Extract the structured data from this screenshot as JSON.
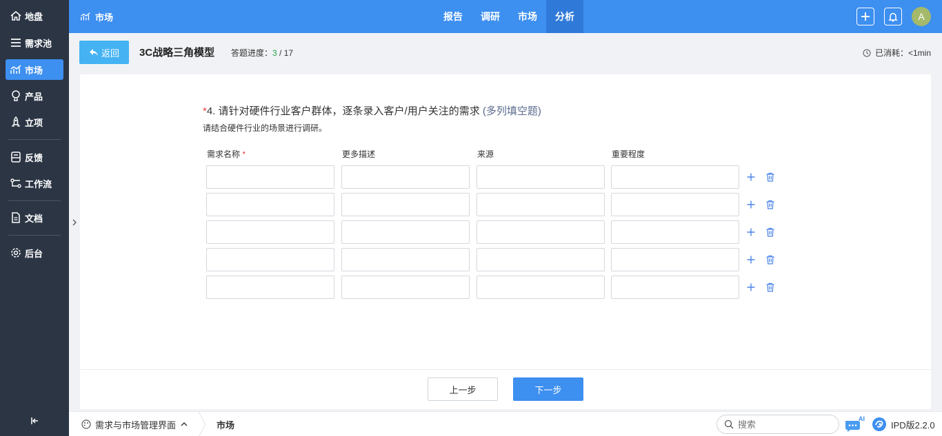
{
  "sidebar": {
    "items": [
      {
        "label": "地盘",
        "icon": "home-icon"
      },
      {
        "label": "需求池",
        "icon": "list-icon"
      },
      {
        "label": "市场",
        "icon": "market-chart-icon",
        "active": true
      },
      {
        "label": "产品",
        "icon": "lightbulb-icon"
      },
      {
        "label": "立项",
        "icon": "rocket-icon"
      },
      {
        "label": "反馈",
        "icon": "feedback-icon"
      },
      {
        "label": "工作流",
        "icon": "workflow-icon"
      },
      {
        "label": "文档",
        "icon": "document-icon"
      },
      {
        "label": "后台",
        "icon": "gear-icon"
      }
    ]
  },
  "topbar": {
    "brand": "市场",
    "nav": [
      "报告",
      "调研",
      "市场",
      "分析"
    ],
    "active_nav": "分析",
    "avatar_initial": "A"
  },
  "header": {
    "back_label": "返回",
    "title": "3C战略三角模型",
    "progress_label": "答题进度：",
    "progress_current": "3",
    "progress_total": " / 17",
    "elapsed_label": "已消耗：<1min"
  },
  "question": {
    "required_mark": "*",
    "title": "4. 请针对硬件行业客户群体，逐条录入客户/用户关注的需求",
    "type": " (多列填空题)",
    "description": "请结合硬件行业的场景进行调研。",
    "columns": [
      {
        "label": "需求名称",
        "required": true
      },
      {
        "label": "更多描述",
        "required": false
      },
      {
        "label": "来源",
        "required": false
      },
      {
        "label": "重要程度",
        "required": false
      }
    ],
    "rows": [
      [
        "",
        "",
        "",
        ""
      ],
      [
        "",
        "",
        "",
        ""
      ],
      [
        "",
        "",
        "",
        ""
      ],
      [
        "",
        "",
        "",
        ""
      ],
      [
        "",
        "",
        "",
        ""
      ]
    ]
  },
  "footer_buttons": {
    "prev": "上一步",
    "next": "下一步"
  },
  "bottombar": {
    "breadcrumb_root": "需求与市场管理界面",
    "breadcrumb_current": "市场",
    "search_placeholder": "搜索",
    "ai_label": "AI",
    "version": "IPD版2.2.0"
  },
  "colors": {
    "primary": "#3d8ff0",
    "sidebar_bg": "#2b3544",
    "back_button": "#45b3f3",
    "progress_current": "#2aa84a",
    "required": "#e54545"
  }
}
